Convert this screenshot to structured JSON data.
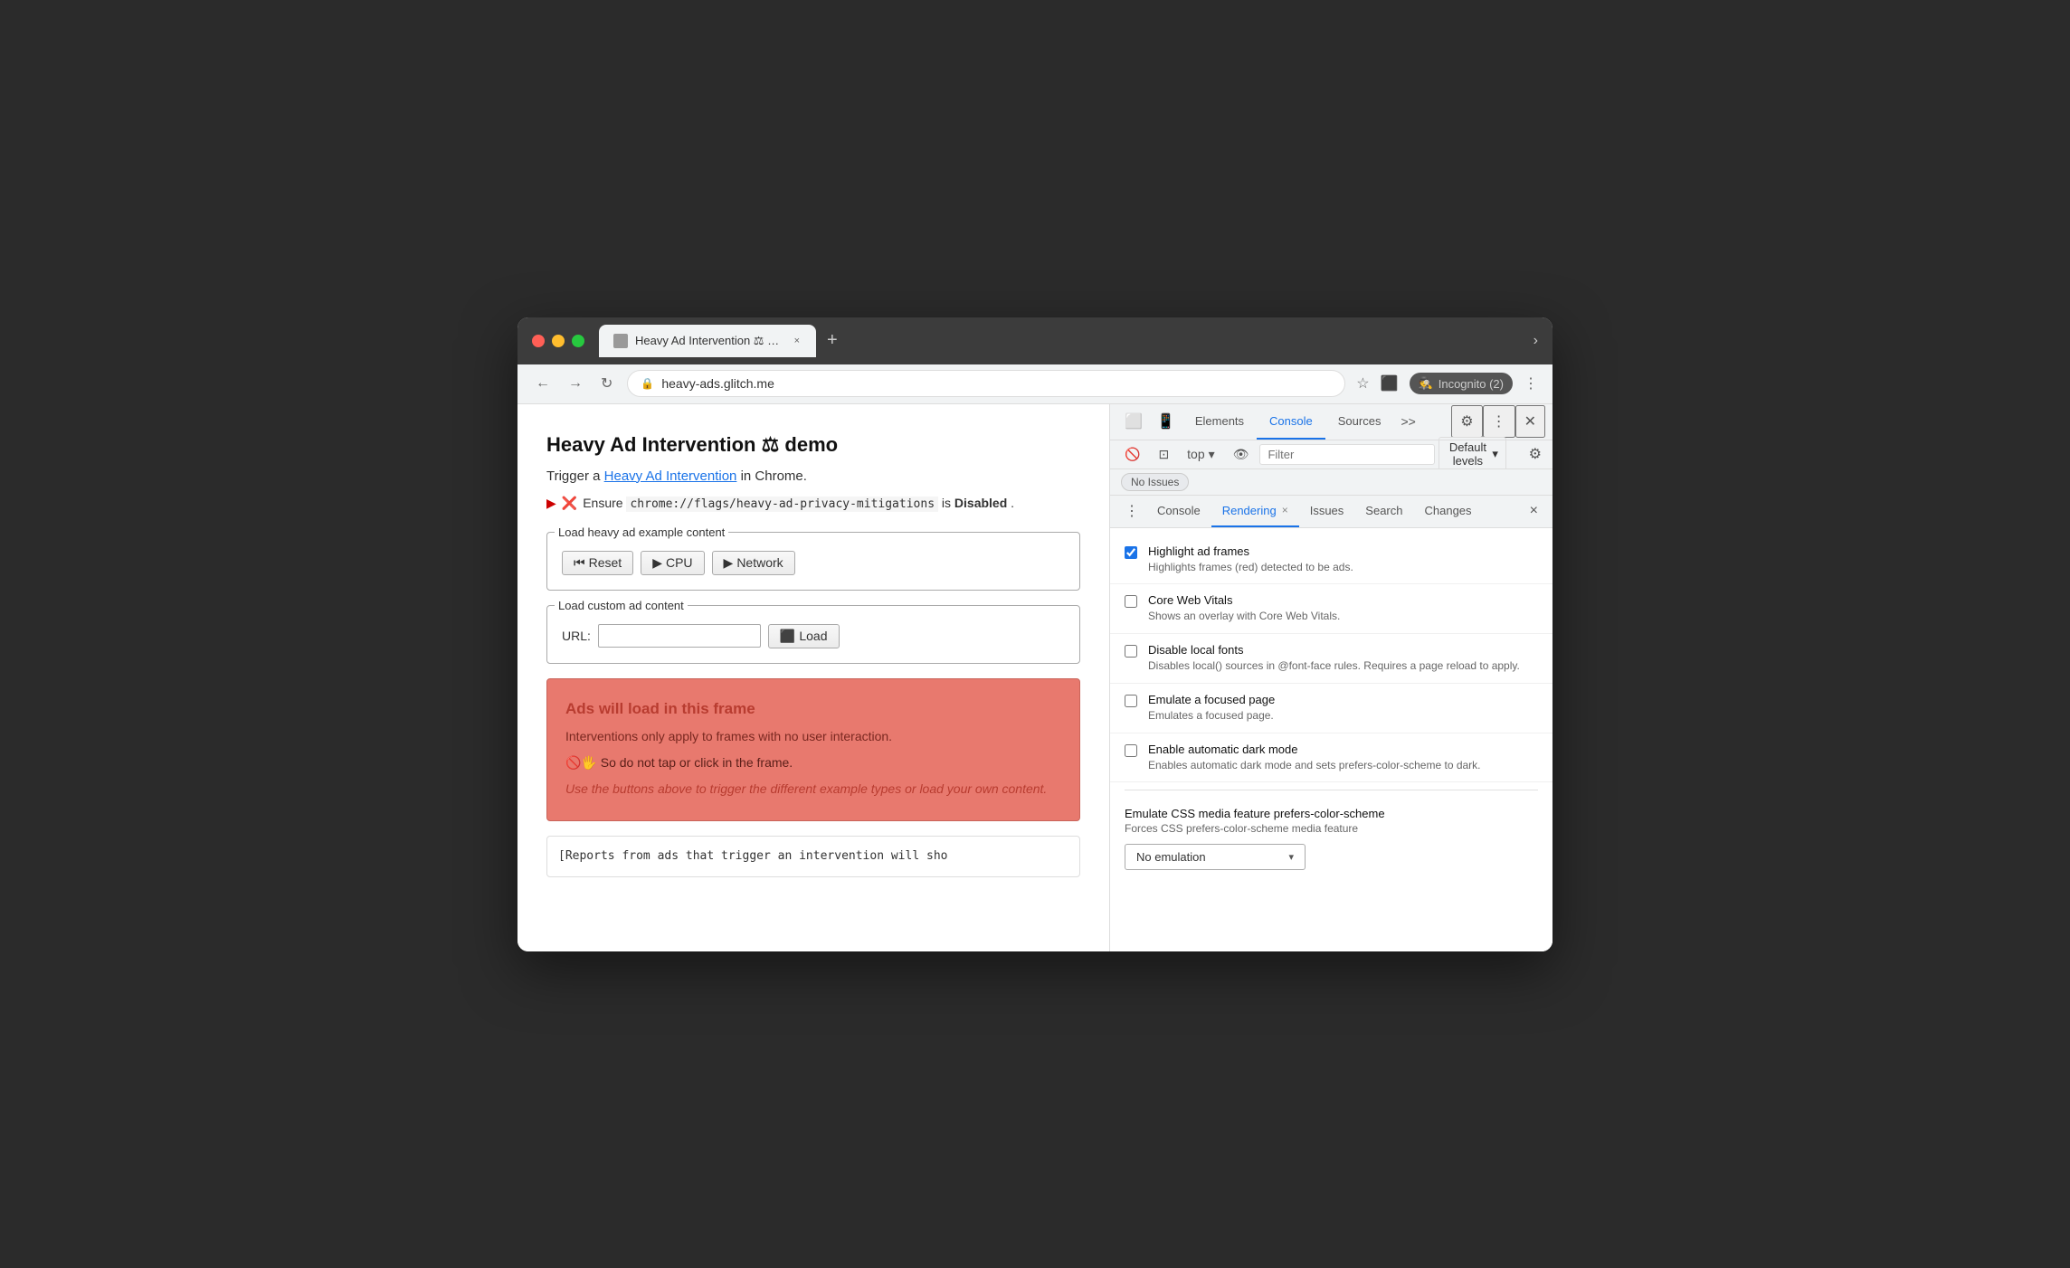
{
  "browser": {
    "title_bar": {
      "tab_title": "Heavy Ad Intervention ⚖ dem...",
      "tab_close": "×",
      "new_tab": "+",
      "more_tabs": "›"
    },
    "address_bar": {
      "url": "heavy-ads.glitch.me",
      "back": "←",
      "forward": "→",
      "refresh": "↻",
      "bookmark": "☆",
      "extensions": "◉",
      "incognito": "Incognito (2)",
      "more": "⋮"
    }
  },
  "webpage": {
    "title": "Heavy Ad Intervention ⚖ demo",
    "subtitle_text": "Trigger a ",
    "subtitle_link": "Heavy Ad Intervention",
    "subtitle_end": " in Chrome.",
    "flag_arrow": "▶",
    "flag_x": "❌",
    "flag_text": "Ensure ",
    "flag_code": "chrome://flags/heavy-ad-privacy-mitigations",
    "flag_end": " is ",
    "flag_bold": "Disabled",
    "flag_period": ".",
    "section1_legend": "Load heavy ad example content",
    "btn_reset": "Reset",
    "btn_cpu": "CPU",
    "btn_network": "Network",
    "section2_legend": "Load custom ad content",
    "url_label": "URL:",
    "url_placeholder": "",
    "btn_load": "Load",
    "ad_frame_heading": "Ads will load in this frame",
    "ad_frame_p1": "Interventions only apply to frames with no user interaction.",
    "ad_frame_warning": "🚫🖐 So do not tap or click in the frame.",
    "ad_frame_italic": "Use the buttons above to trigger the different example types or load your own content.",
    "console_text": "[Reports from ads that trigger an intervention will sho"
  },
  "devtools": {
    "tabs": {
      "elements": "Elements",
      "console": "Console",
      "sources": "Sources",
      "more": ">>"
    },
    "toolbar": {
      "context": "top",
      "eye_icon": "👁",
      "filter_placeholder": "Filter",
      "default_levels": "Default levels",
      "dropdown_arrow": "▾"
    },
    "no_issues": "No Issues",
    "rendering_tabs": {
      "console": "Console",
      "rendering": "Rendering",
      "rendering_close": "×",
      "issues": "Issues",
      "search": "Search",
      "changes": "Changes",
      "close": "×"
    },
    "rendering_items": [
      {
        "id": "highlight-ad",
        "checked": true,
        "title": "Highlight ad frames",
        "desc": "Highlights frames (red) detected to be ads."
      },
      {
        "id": "core-web-vitals",
        "checked": false,
        "title": "Core Web Vitals",
        "desc": "Shows an overlay with Core Web Vitals."
      },
      {
        "id": "disable-local-fonts",
        "checked": false,
        "title": "Disable local fonts",
        "desc": "Disables local() sources in @font-face rules. Requires a page reload to apply."
      },
      {
        "id": "emulate-focused",
        "checked": false,
        "title": "Emulate a focused page",
        "desc": "Emulates a focused page."
      },
      {
        "id": "auto-dark-mode",
        "checked": false,
        "title": "Enable automatic dark mode",
        "desc": "Enables automatic dark mode and sets prefers-color-scheme to dark."
      }
    ],
    "emulate_section": {
      "title": "Emulate CSS media feature prefers-color-scheme",
      "desc": "Forces CSS prefers-color-scheme media feature",
      "select_value": "No emulation",
      "select_arrow": "▾"
    }
  }
}
